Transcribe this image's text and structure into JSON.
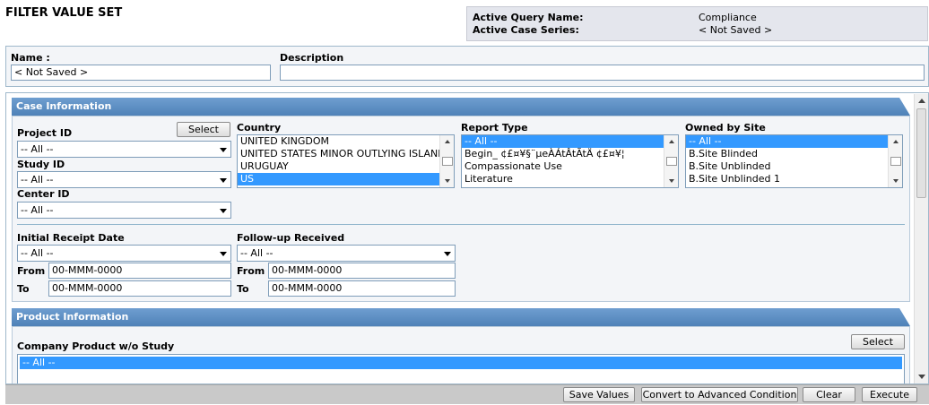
{
  "header": {
    "title": "FILTER VALUE SET",
    "active_query_label": "Active Query Name:",
    "active_query_value": "Compliance",
    "active_case_label": "Active Case Series:",
    "active_case_value": "< Not Saved >"
  },
  "name_panel": {
    "name_label": "Name :",
    "name_value": "< Not Saved >",
    "description_label": "Description",
    "description_value": ""
  },
  "case_info": {
    "heading": "Case Information",
    "project_id_label": "Project ID",
    "project_select_label": "Select",
    "project_id_value": "-- All --",
    "study_id_label": "Study ID",
    "study_id_value": "-- All --",
    "center_id_label": "Center ID",
    "center_id_value": "-- All --",
    "country": {
      "label": "Country",
      "items": [
        "UNITED KINGDOM",
        "UNITED STATES MINOR OUTLYING ISLANDS",
        "URUGUAY",
        "US"
      ],
      "selected_index": 3
    },
    "report_type": {
      "label": "Report Type",
      "items": [
        "-- All --",
        "Begin_ ¢£¤¥§¨µeÀÁtÂtÃtÄ ¢£¤¥¦",
        "Compassionate Use",
        "Literature"
      ],
      "selected_index": 0
    },
    "owned_by_site": {
      "label": "Owned by Site",
      "items": [
        "-- All --",
        "B.Site Blinded",
        "B.Site Unblinded",
        "B.Site Unblinded 1"
      ],
      "selected_index": 0
    },
    "initial_receipt": {
      "label": "Initial Receipt Date",
      "value": "-- All --",
      "from_label": "From",
      "from_value": "00-MMM-0000",
      "to_label": "To",
      "to_value": "00-MMM-0000"
    },
    "followup": {
      "label": "Follow-up Received",
      "value": "-- All --",
      "from_label": "From",
      "from_value": "00-MMM-0000",
      "to_label": "To",
      "to_value": "00-MMM-0000"
    }
  },
  "product_info": {
    "heading": "Product Information",
    "company_product_label": "Company Product w/o Study",
    "select_label": "Select",
    "items": [
      "-- All --"
    ]
  },
  "footer": {
    "save_values": "Save Values",
    "convert": "Convert to Advanced Condition",
    "clear": "Clear",
    "execute": "Execute"
  },
  "colors": {
    "section_header": "#5b8dc4",
    "selection": "#3399ff",
    "panel_bg": "#f3f5f8",
    "footer_bg": "#c9c9c9"
  }
}
